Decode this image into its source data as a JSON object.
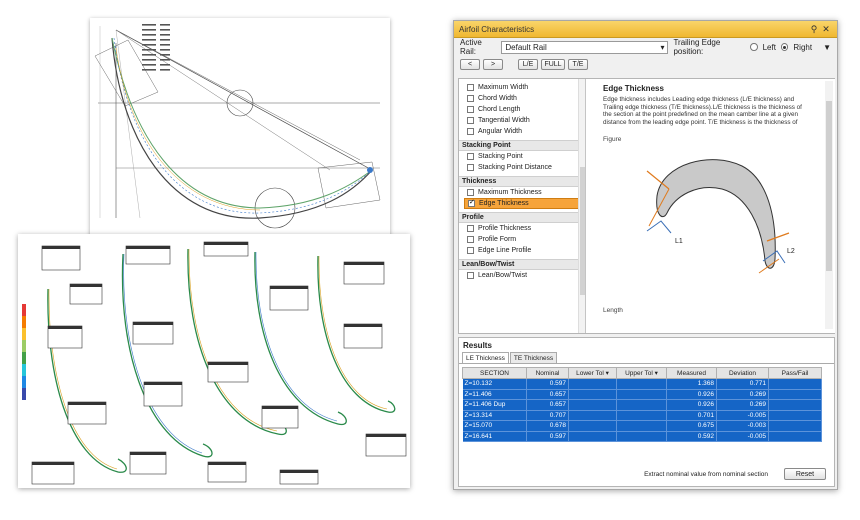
{
  "window": {
    "title": "Airfoil Characteristics"
  },
  "rail": {
    "label": "Active Rail:",
    "value": "Default Rail"
  },
  "trailing_edge": {
    "label": "Trailing Edge position:",
    "left": "Left",
    "right": "Right",
    "selected": "Right"
  },
  "nav": {
    "prev": "<",
    "next": ">",
    "le": "L/E",
    "full": "FULL",
    "te": "T/E"
  },
  "groups": [
    {
      "items": [
        "Maximum Width",
        "Chord Width",
        "Chord Length",
        "Tangential Width",
        "Angular Width"
      ]
    },
    {
      "title": "Stacking Point",
      "items": [
        "Stacking Point",
        "Stacking Point Distance"
      ]
    },
    {
      "title": "Thickness",
      "items": [
        "Maximum Thickness",
        "Edge Thickness"
      ]
    },
    {
      "title": "Profile",
      "items": [
        "Profile Thickness",
        "Profile Form",
        "Edge Line Profile"
      ]
    },
    {
      "title": "Lean/Bow/Twist",
      "items": [
        "Lean/Bow/Twist"
      ]
    }
  ],
  "selected_item": "Edge Thickness",
  "detail": {
    "title": "Edge Thickness",
    "description": "Edge thickness includes Leading edge thickness (L/E thickness) and Trailing edge thickness (T/E thickness).L/E thickness is the thickness of the section at the point predefined on the mean camber line at a given distance from the leading edge point. T/E thickness is the thickness of",
    "figure_label": "Figure",
    "length_label": "Length",
    "l1": "L1",
    "l2": "L2"
  },
  "results": {
    "title": "Results",
    "tabs": [
      "LE Thickness",
      "TE Thickness"
    ],
    "columns": [
      "SECTION",
      "Nominal",
      "Lower Tol",
      "Upper Tol",
      "Measured",
      "Deviation",
      "Pass/Fail"
    ],
    "rows": [
      [
        "Z=10.132",
        "0.597",
        "",
        "",
        "1.368",
        "0.771",
        ""
      ],
      [
        "Z=11.406",
        "0.657",
        "",
        "",
        "0.926",
        "0.269",
        ""
      ],
      [
        "Z=11.406  Dup",
        "0.657",
        "",
        "",
        "0.926",
        "0.269",
        ""
      ],
      [
        "Z=13.314",
        "0.707",
        "",
        "",
        "0.701",
        "-0.005",
        ""
      ],
      [
        "Z=15.070",
        "0.678",
        "",
        "",
        "0.675",
        "-0.003",
        ""
      ],
      [
        "Z=16.641",
        "0.597",
        "",
        "",
        "0.592",
        "-0.005",
        ""
      ]
    ],
    "footer_label": "Extract nominal value from nominal section",
    "reset": "Reset"
  },
  "colors": {
    "title_bar": "#f0b730",
    "selection": "#1565c6",
    "highlight": "#f6a43b"
  }
}
